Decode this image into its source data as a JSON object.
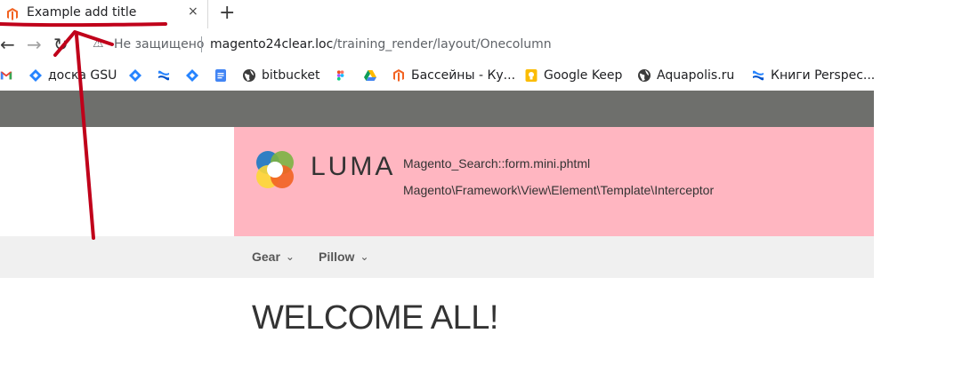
{
  "browser": {
    "tab": {
      "title": "Example add title",
      "close": "×"
    },
    "new_tab": "+",
    "security_text": "Не защищено",
    "url_host": "magento24clear.loc",
    "url_path": "/training_render/layout/Onecolumn",
    "bookmarks": [
      {
        "label": "",
        "icon": "gmail-icon"
      },
      {
        "label": "доска GSU",
        "icon": "jira-icon"
      },
      {
        "label": "",
        "icon": "jira-icon"
      },
      {
        "label": "",
        "icon": "confluence-icon"
      },
      {
        "label": "",
        "icon": "jira-icon"
      },
      {
        "label": "",
        "icon": "docs-icon"
      },
      {
        "label": "bitbucket",
        "icon": "globe-icon"
      },
      {
        "label": "",
        "icon": "figma-icon"
      },
      {
        "label": "",
        "icon": "drive-icon"
      },
      {
        "label": "Бассейны - Ку...",
        "icon": "magento-icon"
      },
      {
        "label": "Google Keep",
        "icon": "keep-icon"
      },
      {
        "label": "Aquapolis.ru",
        "icon": "globe-icon"
      },
      {
        "label": "Книги Perspec...",
        "icon": "confluence-icon"
      }
    ]
  },
  "page": {
    "logo_text": "LUMA",
    "template_lines": [
      "Magento_Search::form.mini.phtml",
      "Magento\\Framework\\View\\Element\\Template\\Interceptor"
    ],
    "menu": [
      {
        "label": "Gear"
      },
      {
        "label": "Pillow"
      }
    ],
    "welcome": "WELCOME ALL!"
  },
  "colors": {
    "header_bg": "#ffb6c1",
    "top_bar": "#6e6f6c",
    "nav_bg": "#f0f0f0",
    "annotation": "#c0001a"
  }
}
